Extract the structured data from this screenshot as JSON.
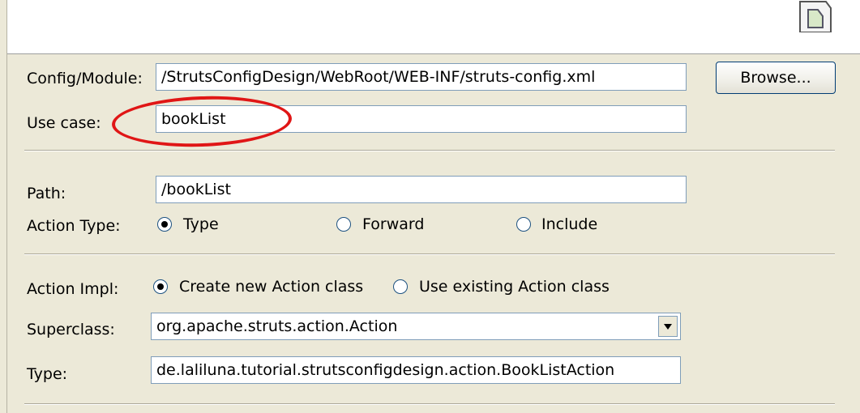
{
  "config": {
    "module_label": "Config/Module:",
    "module_value": "/StrutsConfigDesign/WebRoot/WEB-INF/struts-config.xml",
    "browse_label": "Browse...",
    "use_case_label": "Use case:",
    "use_case_value": "bookList"
  },
  "action": {
    "path_label": "Path:",
    "path_value": "/bookList",
    "type_label": "Action Type:",
    "type_options": [
      "Type",
      "Forward",
      "Include"
    ],
    "type_selected": "Type"
  },
  "impl": {
    "label": "Action Impl:",
    "options": [
      "Create new Action class",
      "Use existing Action class"
    ],
    "selected": "Create new Action class",
    "superclass_label": "Superclass:",
    "superclass_value": "org.apache.struts.action.Action",
    "type_label": "Type:",
    "type_value": "de.laliluna.tutorial.strutsconfigdesign.action.BookListAction"
  },
  "annotation_color": "#e01616"
}
